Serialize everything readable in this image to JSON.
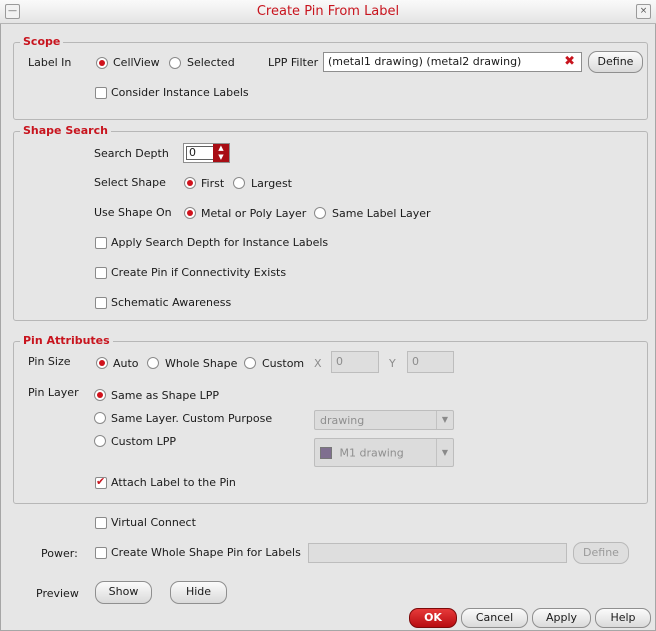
{
  "window": {
    "title": "Create Pin From Label",
    "menu_icon": "menu-icon",
    "close_icon": "close-icon"
  },
  "scope": {
    "legend": "Scope",
    "label_in": "Label In",
    "cellview": "CellView",
    "selected": "Selected",
    "selected_option": "CellView",
    "lpp_filter_label": "LPP Filter",
    "lpp_filter_value": "(metal1 drawing) (metal2 drawing)",
    "clear_icon": "clear-icon",
    "define": "Define",
    "consider_instance_labels": "Consider Instance Labels",
    "consider_instance_labels_checked": false
  },
  "shape_search": {
    "legend": "Shape Search",
    "search_depth_label": "Search Depth",
    "search_depth_value": "0",
    "select_shape_label": "Select Shape",
    "first": "First",
    "largest": "Largest",
    "use_shape_on_label": "Use Shape On",
    "metal_or_poly": "Metal or Poly Layer",
    "same_label_layer": "Same Label Layer",
    "apply_search_depth": "Apply Search Depth for Instance Labels",
    "create_pin_connectivity": "Create Pin if Connectivity Exists",
    "schematic_awareness": "Schematic Awareness"
  },
  "pin_attributes": {
    "legend": "Pin Attributes",
    "pin_size_label": "Pin Size",
    "auto": "Auto",
    "whole_shape": "Whole Shape",
    "custom": "Custom",
    "x_label": "X",
    "x_value": "0",
    "y_label": "Y",
    "y_value": "0",
    "pin_layer_label": "Pin Layer",
    "same_as_shape_lpp": "Same as Shape LPP",
    "same_layer_custom_purpose": "Same Layer. Custom Purpose",
    "purpose_value": "drawing",
    "custom_lpp": "Custom LPP",
    "lpp_value": "M1 drawing",
    "layer_swatch_color": "#7f6f8f",
    "attach_label": "Attach Label to the Pin",
    "attach_label_checked": true
  },
  "extra": {
    "virtual_connect": "Virtual Connect",
    "power_label": "Power:",
    "create_whole_shape_pin": "Create Whole Shape Pin for Labels",
    "power_define": "Define",
    "preview_label": "Preview",
    "show": "Show",
    "hide": "Hide"
  },
  "footer": {
    "ok": "OK",
    "cancel": "Cancel",
    "apply": "Apply",
    "help": "Help"
  },
  "colors": {
    "accent": "#c8141e",
    "background": "#e6e6e6"
  }
}
